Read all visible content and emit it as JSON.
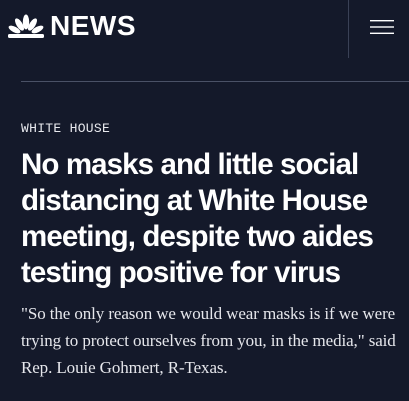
{
  "header": {
    "brand": "NEWS",
    "logo_icon": "nbc-peacock-icon",
    "menu_icon": "hamburger-menu-icon"
  },
  "article": {
    "section": "WHITE HOUSE",
    "headline": "No masks and little social distancing at White House meeting, despite two aides testing positive for virus",
    "dek": "\"So the only reason we would wear masks is if we were trying to protect ourselves from you, in the media,\" said Rep. Louie Gohmert, R-Texas."
  },
  "colors": {
    "background": "#14192a",
    "text": "#ffffff",
    "divider": "#4a5166"
  }
}
